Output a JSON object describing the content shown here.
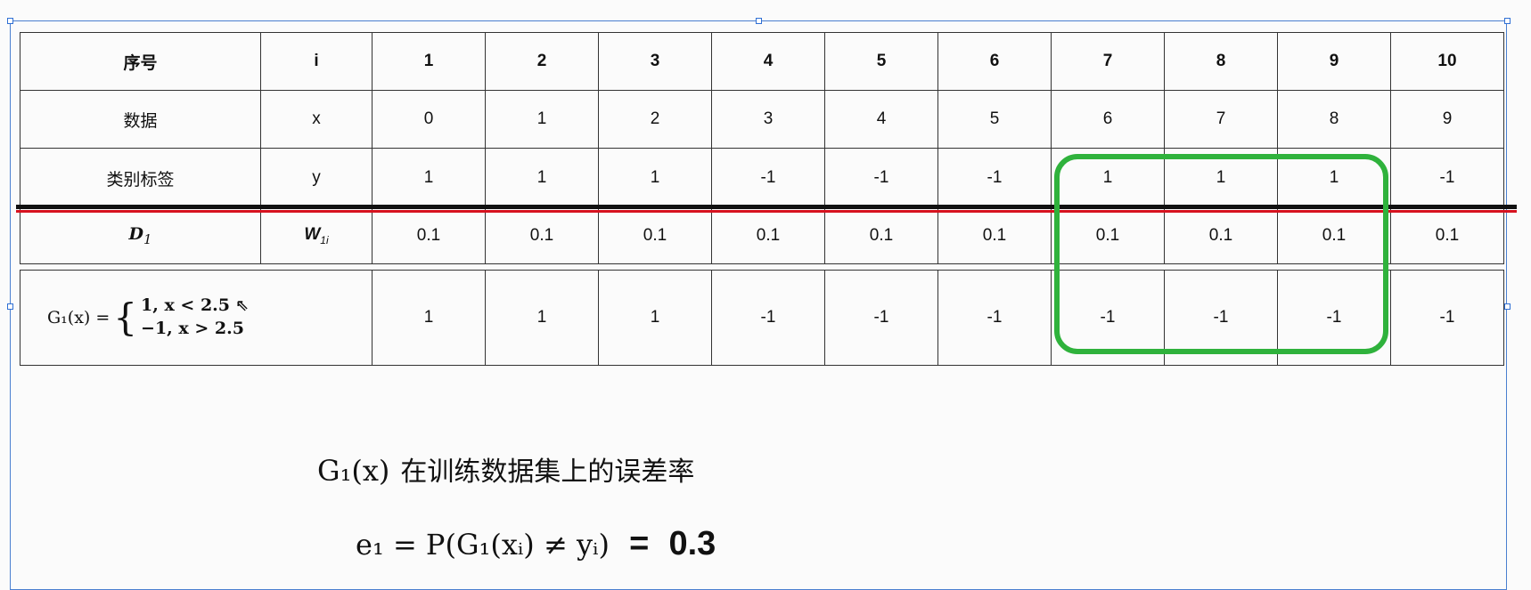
{
  "table": {
    "header": [
      "序号",
      "i",
      "1",
      "2",
      "3",
      "4",
      "5",
      "6",
      "7",
      "8",
      "9",
      "10"
    ],
    "data_row": {
      "label": "数据",
      "sym": "x",
      "values": [
        "0",
        "1",
        "2",
        "3",
        "4",
        "5",
        "6",
        "7",
        "8",
        "9"
      ]
    },
    "label_row": {
      "label": "类别标签",
      "sym": "y",
      "values": [
        "1",
        "1",
        "1",
        "-1",
        "-1",
        "-1",
        "1",
        "1",
        "1",
        "-1"
      ]
    },
    "weight_row": {
      "label_main": "D",
      "label_sub": "1",
      "sym_main": "W",
      "sym_sub": "1i",
      "values": [
        "0.1",
        "0.1",
        "0.1",
        "0.1",
        "0.1",
        "0.1",
        "0.1",
        "0.1",
        "0.1",
        "0.1"
      ]
    },
    "classifier_row": {
      "func": "G₁(x) =",
      "case1": "1,    x < 2.5",
      "case2": "−1,   x > 2.5",
      "values": [
        "1",
        "1",
        "1",
        "-1",
        "-1",
        "-1",
        "-1",
        "-1",
        "-1",
        "-1"
      ]
    }
  },
  "formula1": {
    "math": "G₁(x)",
    "text": "在训练数据集上的误差率"
  },
  "formula2": {
    "math": "e₁ = P(G₁(xᵢ) ≠ yᵢ)",
    "eq": "=",
    "answer": "0.3"
  },
  "colors": {
    "highlight_box": "#2fb23c",
    "separator": "#d6121f",
    "selection_frame": "#4a7fd0"
  }
}
